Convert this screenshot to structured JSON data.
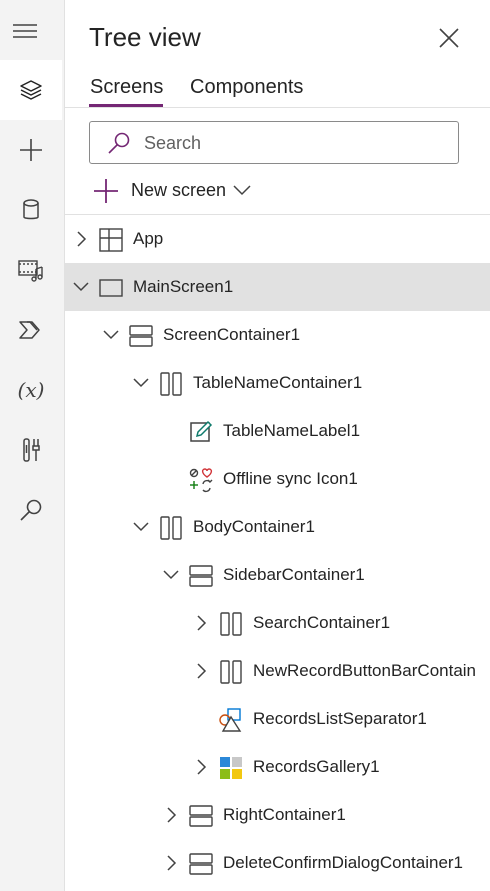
{
  "rail": {
    "items": [
      {
        "icon": "layers-icon",
        "active": true
      },
      {
        "icon": "plus-icon"
      },
      {
        "icon": "database-icon"
      },
      {
        "icon": "media-icon"
      },
      {
        "icon": "power-automate-icon"
      },
      {
        "icon": "variables-icon"
      },
      {
        "icon": "tools-icon"
      },
      {
        "icon": "search-icon"
      }
    ]
  },
  "panel": {
    "title": "Tree view",
    "tabs": [
      {
        "label": "Screens",
        "active": true
      },
      {
        "label": "Components"
      }
    ],
    "search_placeholder": "Search",
    "new_screen_label": "New screen"
  },
  "tree": [
    {
      "label": "App",
      "level": 0,
      "chevron": "collapsed",
      "icon": "app-icon"
    },
    {
      "label": "MainScreen1",
      "level": 0,
      "chevron": "expanded",
      "icon": "screen-icon",
      "selected": true
    },
    {
      "label": "ScreenContainer1",
      "level": 1,
      "chevron": "expanded",
      "icon": "vertical-container-icon"
    },
    {
      "label": "TableNameContainer1",
      "level": 2,
      "chevron": "expanded",
      "icon": "horizontal-container-icon"
    },
    {
      "label": "TableNameLabel1",
      "level": 3,
      "chevron": "none",
      "icon": "label-icon"
    },
    {
      "label": "Offline sync Icon1",
      "level": 3,
      "chevron": "none",
      "icon": "icon-control-icon"
    },
    {
      "label": "BodyContainer1",
      "level": 2,
      "chevron": "expanded",
      "icon": "horizontal-container-icon"
    },
    {
      "label": "SidebarContainer1",
      "level": 3,
      "chevron": "expanded",
      "icon": "vertical-container-icon"
    },
    {
      "label": "SearchContainer1",
      "level": 4,
      "chevron": "collapsed",
      "icon": "horizontal-container-icon"
    },
    {
      "label": "NewRecordButtonBarContain",
      "level": 4,
      "chevron": "collapsed",
      "icon": "horizontal-container-icon"
    },
    {
      "label": "RecordsListSeparator1",
      "level": 4,
      "chevron": "none",
      "icon": "shape-icon"
    },
    {
      "label": "RecordsGallery1",
      "level": 4,
      "chevron": "collapsed",
      "icon": "gallery-icon"
    },
    {
      "label": "RightContainer1",
      "level": 3,
      "chevron": "collapsed",
      "icon": "vertical-container-icon"
    },
    {
      "label": "DeleteConfirmDialogContainer1",
      "level": 3,
      "chevron": "collapsed",
      "icon": "vertical-container-icon"
    }
  ],
  "colors": {
    "accent": "#742774",
    "selected_row": "#e1e1e1",
    "rail_bg": "#f3f3f3"
  }
}
